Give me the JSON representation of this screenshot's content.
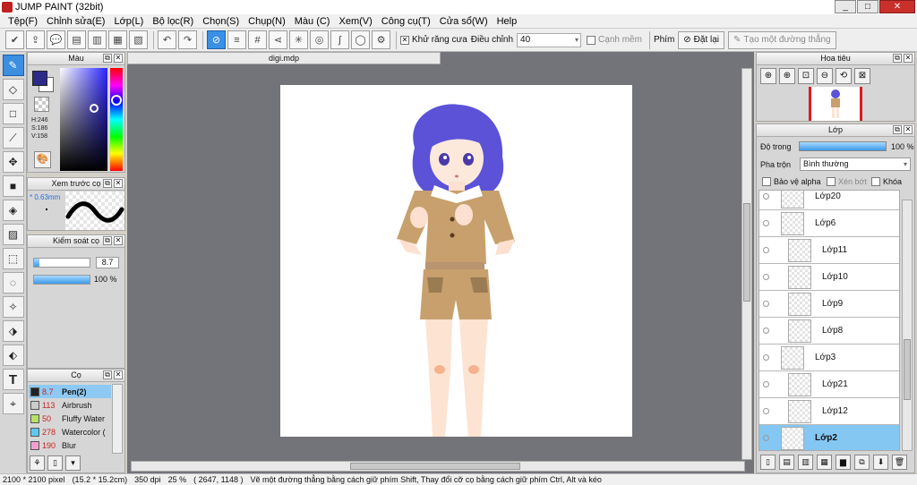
{
  "window": {
    "title": "JUMP PAINT (32bit)",
    "minimize": "_",
    "maximize": "□",
    "close": "✕"
  },
  "menu": [
    "Tệp(F)",
    "Chỉnh sửa(E)",
    "Lớp(L)",
    "Bộ lọc(R)",
    "Chọn(S)",
    "Chụp(N)",
    "Màu (C)",
    "Xem(V)",
    "Công cụ(T)",
    "Cửa sổ(W)",
    "Help"
  ],
  "toolbar": {
    "antialias_label": "Khử răng cưa",
    "antialias_checked": true,
    "adjust_label": "Điều chỉnh",
    "adjust_value": "40",
    "smooth_edge_label": "Cạnh mềm",
    "smooth_edge_checked": false,
    "key_label": "Phím",
    "reset_label": "Đặt lại",
    "straight_line_label": "Tạo một đường thẳng"
  },
  "color_panel": {
    "title": "Màu",
    "h": "H:246",
    "s": "S:186",
    "v": "V:158",
    "foreground": "#2d2a8a",
    "background": "#ffffff"
  },
  "preview_panel": {
    "title": "Xem trước cọ",
    "size": "0.63mm"
  },
  "control_panel": {
    "title": "Kiểm soát cọ",
    "size_value": "8.7",
    "opacity_value": "100 %",
    "opacity_level": 1.0,
    "size_level": 0.1
  },
  "brush_panel": {
    "title": "Cọ",
    "brushes": [
      {
        "size": "8.7",
        "name": "Pen(2)",
        "color": "#222222",
        "selected": true
      },
      {
        "size": "113",
        "name": "Airbrush",
        "color": "#cccccc",
        "selected": false
      },
      {
        "size": "50",
        "name": "Fluffy Water",
        "color": "#b8e068",
        "selected": false
      },
      {
        "size": "278",
        "name": "Watercolor (",
        "color": "#5ec8f0",
        "selected": false
      },
      {
        "size": "190",
        "name": "Blur",
        "color": "#f0a0d0",
        "selected": false
      }
    ]
  },
  "canvas": {
    "tab": "digi.mdp"
  },
  "navigator": {
    "title": "Hoa tiêu"
  },
  "layer_panel": {
    "title": "Lớp",
    "opacity_label": "Độ trong",
    "opacity_value": "100 %",
    "opacity_level": 1.0,
    "blend_label": "Pha trộn",
    "blend_value": "Bình thường",
    "protect_alpha": "Bảo vệ alpha",
    "clipping": "Xén bớt",
    "lock": "Khóa",
    "layers": [
      {
        "name": "Lớp20",
        "indent": 1,
        "selected": false
      },
      {
        "name": "Lớp6",
        "indent": 1,
        "selected": false
      },
      {
        "name": "Lớp11",
        "indent": 2,
        "selected": false
      },
      {
        "name": "Lớp10",
        "indent": 2,
        "selected": false
      },
      {
        "name": "Lớp9",
        "indent": 2,
        "selected": false
      },
      {
        "name": "Lớp8",
        "indent": 2,
        "selected": false
      },
      {
        "name": "Lớp3",
        "indent": 1,
        "selected": false
      },
      {
        "name": "Lớp21",
        "indent": 2,
        "selected": false
      },
      {
        "name": "Lớp12",
        "indent": 2,
        "selected": false
      },
      {
        "name": "Lớp2",
        "indent": 1,
        "selected": true
      }
    ]
  },
  "status": {
    "size": "2100 * 2100 pixel",
    "physical": "(15.2 * 15.2cm)",
    "dpi": "350 dpi",
    "zoom": "25 %",
    "coords": "( 2647, 1148 )",
    "hint": "Vẽ một đường thẳng bằng cách giữ phím Shift, Thay đổi cỡ cọ bằng cách giữ phím Ctrl, Alt và kéo"
  }
}
